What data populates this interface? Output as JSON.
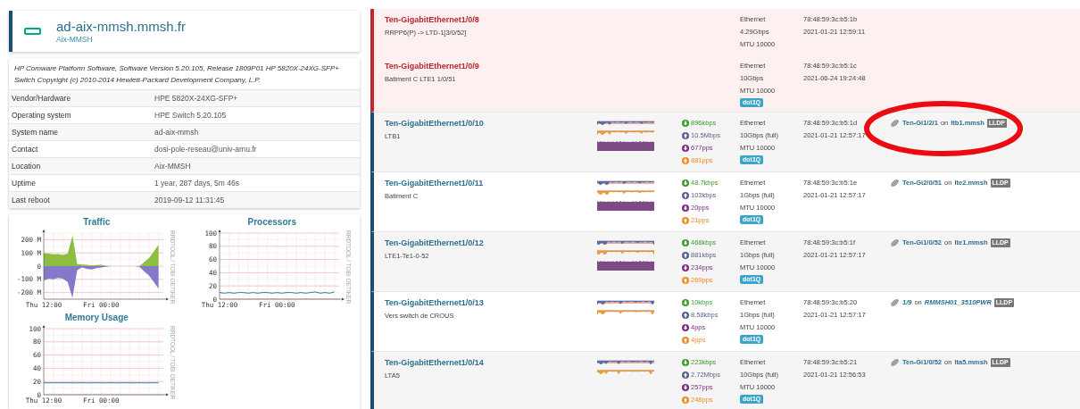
{
  "device": {
    "hostname": "ad-aix-mmsh.mmsh.fr",
    "location": "Aix-MMSH"
  },
  "description": "HP Comware Platform Software, Software Version 5.20.105, Release 1809P01 HP 5820X-24XG-SFP+ Switch Copyright (c) 2010-2014 Hewlett-Packard Development Company, L.P.",
  "info": [
    {
      "label": "Vendor/Hardware",
      "value": "HPE 5820X-24XG-SFP+"
    },
    {
      "label": "Operating system",
      "value": "HPE Switch 5.20.105"
    },
    {
      "label": "System name",
      "value": "ad-aix-mmsh"
    },
    {
      "label": "Contact",
      "value": "dosi-pole-reseau@univ-amu.fr"
    },
    {
      "label": "Location",
      "value": "Aix-MMSH"
    },
    {
      "label": "Uptime",
      "value": "1 year, 287 days, 5m 46s"
    },
    {
      "label": "Last reboot",
      "value": "2019-09-12 11:31:45"
    }
  ],
  "graphs": [
    {
      "side_label": "RRDTOOL / TOBI OETIKER",
      "chart_data": {
        "type": "area",
        "title": "Traffic",
        "grid": true,
        "categories": [
          "Thu 12:00",
          null,
          null,
          null,
          null,
          null,
          null,
          null,
          null,
          null,
          null,
          null,
          "Fri 00:00",
          null,
          null,
          null,
          null,
          null,
          null,
          null,
          null,
          null,
          null,
          null,
          null
        ],
        "ylim": [
          -250,
          250
        ],
        "yticks": [
          {
            "value": 200,
            "label": "200 M"
          },
          {
            "value": 100,
            "label": "100 M"
          },
          {
            "value": 0,
            "label": "0"
          },
          {
            "value": -100,
            "label": "-100 M"
          },
          {
            "value": -200,
            "label": "-200 M"
          }
        ],
        "series": [
          {
            "color": "#8cbf3f",
            "values": [
              100,
              95,
              90,
              92,
              85,
              95,
              230,
              15,
              12,
              10,
              5,
              8,
              10,
              2,
              0,
              0,
              0,
              0,
              0,
              0,
              0,
              30,
              60,
              110,
              160
            ]
          },
          {
            "color": "#8478c8",
            "values": [
              -110,
              -95,
              -100,
              -90,
              -95,
              -120,
              -240,
              -30,
              -10,
              -20,
              -25,
              -15,
              -10,
              -5,
              0,
              0,
              0,
              0,
              0,
              0,
              -5,
              -40,
              -70,
              -120,
              -170
            ]
          }
        ]
      }
    },
    {
      "side_label": "RRDTOOL / TOBI OETIKER",
      "chart_data": {
        "type": "line",
        "title": "Processors",
        "grid": true,
        "categories": [
          "Thu 12:00",
          null,
          null,
          null,
          null,
          null,
          null,
          null,
          null,
          null,
          null,
          null,
          "Fri 00:00",
          null,
          null,
          null,
          null,
          null,
          null,
          null,
          null,
          null,
          null,
          null,
          null
        ],
        "ylim": [
          0,
          100
        ],
        "yticks": [
          0,
          20,
          40,
          60,
          80,
          100
        ],
        "series": [
          {
            "color": "#2f7a99",
            "values": [
              10,
              9,
              10,
              9,
              10,
              10,
              9,
              10,
              9,
              10,
              10,
              9,
              10,
              9,
              10,
              10,
              9,
              10,
              9,
              10,
              11,
              9,
              10,
              9,
              11
            ]
          }
        ]
      }
    },
    {
      "side_label": "RRDTOOL / TOBI OETIKER",
      "chart_data": {
        "type": "line",
        "title": "Memory Usage",
        "grid": true,
        "categories": [
          "Thu 12:00",
          null,
          null,
          null,
          null,
          null,
          null,
          null,
          null,
          null,
          null,
          null,
          "Fri 00:00",
          null,
          null,
          null,
          null,
          null,
          null,
          null,
          null,
          null,
          null,
          null,
          null
        ],
        "ylim": [
          0,
          100
        ],
        "yticks": [
          0,
          20,
          40,
          60,
          80,
          100
        ],
        "series": [
          {
            "color": "#2f7a99",
            "values": [
              18,
              18,
              18,
              18,
              18,
              18,
              18,
              18,
              18,
              18,
              18,
              18,
              18,
              18,
              18,
              18,
              18,
              18,
              18,
              18,
              18,
              18,
              18,
              18,
              18
            ]
          }
        ]
      }
    }
  ],
  "ports": [
    {
      "name": "Ten-GigabitEthernet1/0/8",
      "down": true,
      "description": "RRPP6(P) -> LTD-1[3/0/52]",
      "graph": false,
      "highlighted": false,
      "media": [
        "Ethernet",
        "4.29Gbps",
        "MTU 10000"
      ],
      "mac": "78:48:59:3c:b5:1b",
      "changed": "2021-01-21 12:59:11"
    },
    {
      "name": "Ten-GigabitEthernet1/0/9",
      "down": true,
      "description": "Batiment C LTE1 1/0/51",
      "graph": false,
      "highlighted": false,
      "media": [
        "Ethernet",
        "10Gbps",
        "MTU 10000"
      ],
      "badge": "dot1Q",
      "mac": "78:48:59:3c:b5:1c",
      "changed": "2021-06-24 19:24:48"
    },
    {
      "name": "Ten-GigabitEthernet1/0/10",
      "down": false,
      "description": "LTB1",
      "graph": true,
      "highlighted": true,
      "stats": [
        {
          "kind": "in_bits",
          "text": "896kbps"
        },
        {
          "kind": "out_bits",
          "text": "10.5Mbps"
        },
        {
          "kind": "in_pkts",
          "text": "677pps"
        },
        {
          "kind": "out_pkts",
          "text": "881pps"
        }
      ],
      "media": [
        "Ethernet",
        "10Gbps (full)",
        "MTU 10000"
      ],
      "badge": "dot1Q",
      "mac": "78:48:59:3c:b5:1d",
      "changed": "2021-01-21 12:57:17",
      "neighbor": {
        "port": "Ten-Gi1/2/1",
        "joiner": "on",
        "host": "ltb1.mmsh",
        "protocol": "LLDP",
        "italic": false
      }
    },
    {
      "name": "Ten-GigabitEthernet1/0/11",
      "down": false,
      "description": "Batiment C",
      "graph": true,
      "highlighted": false,
      "stats": [
        {
          "kind": "in_bits",
          "text": "48.7kbps"
        },
        {
          "kind": "out_bits",
          "text": "103kbps"
        },
        {
          "kind": "in_pkts",
          "text": "20pps"
        },
        {
          "kind": "out_pkts",
          "text": "21pps"
        }
      ],
      "media": [
        "Ethernet",
        "1Gbps (full)",
        "MTU 10000"
      ],
      "badge": "dot1Q",
      "mac": "78:48:59:3c:b5:1e",
      "changed": "2021-01-21 12:57:17",
      "neighbor": {
        "port": "Ten-Gi2/0/51",
        "joiner": "on",
        "host": "lte2.mmsh",
        "protocol": "LLDP",
        "italic": false
      }
    },
    {
      "name": "Ten-GigabitEthernet1/0/12",
      "down": false,
      "description": "LTE1-Te1-0-52",
      "graph": true,
      "highlighted": false,
      "stats": [
        {
          "kind": "in_bits",
          "text": "468kbps"
        },
        {
          "kind": "out_bits",
          "text": "881kbps"
        },
        {
          "kind": "in_pkts",
          "text": "234pps"
        },
        {
          "kind": "out_pkts",
          "text": "269pps"
        }
      ],
      "media": [
        "Ethernet",
        "1Gbps (full)",
        "MTU 10000"
      ],
      "badge": "dot1Q",
      "mac": "78:48:59:3c:b5:1f",
      "changed": "2021-01-21 12:57:17",
      "neighbor": {
        "port": "Ten-Gi1/0/52",
        "joiner": "on",
        "host": "lte1.mmsh",
        "protocol": "LLDP",
        "italic": false
      }
    },
    {
      "name": "Ten-GigabitEthernet1/0/13",
      "down": false,
      "description": "Vers switch de CROUS",
      "graph": true,
      "highlighted": false,
      "stats": [
        {
          "kind": "in_bits",
          "text": "10kbps"
        },
        {
          "kind": "out_bits",
          "text": "8.58kbps"
        },
        {
          "kind": "in_pkts",
          "text": "4pps"
        },
        {
          "kind": "out_pkts",
          "text": "4pps"
        }
      ],
      "media": [
        "Ethernet",
        "1Gbps (full)",
        "MTU 10000"
      ],
      "badge": "dot1Q",
      "mac": "78:48:59:3c:b5:20",
      "changed": "2021-01-21 12:57:17",
      "neighbor": {
        "port": "1/9",
        "joiner": "on",
        "host": "RMMSH01_3510PWR",
        "protocol": "LLDP",
        "italic": true
      }
    },
    {
      "name": "Ten-GigabitEthernet1/0/14",
      "down": false,
      "description": "LTA5",
      "graph": true,
      "highlighted": false,
      "stats": [
        {
          "kind": "in_bits",
          "text": "223kbps"
        },
        {
          "kind": "out_bits",
          "text": "2.72Mbps"
        },
        {
          "kind": "in_pkts",
          "text": "257pps"
        },
        {
          "kind": "out_pkts",
          "text": "248pps"
        }
      ],
      "media": [
        "Ethernet",
        "10Gbps (full)",
        "MTU 10000"
      ],
      "badge": "dot1Q",
      "mac": "78:48:59:3c:b5:21",
      "changed": "2021-01-21 12:56:53",
      "neighbor": {
        "port": "Ten-Gi1/0/52",
        "joiner": "on",
        "host": "lta5.mmsh",
        "protocol": "LLDP",
        "italic": false
      }
    }
  ]
}
